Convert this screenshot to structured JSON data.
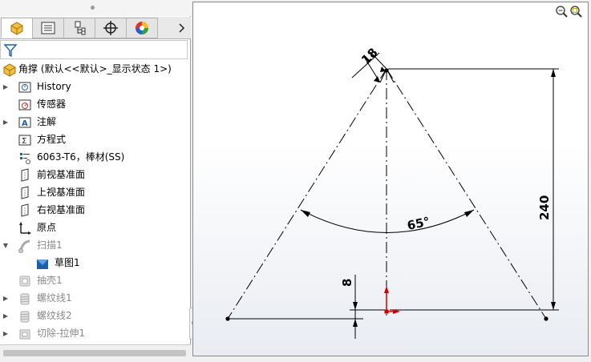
{
  "panel": {
    "tabs": [
      {
        "icon": "part-icon",
        "active": true
      },
      {
        "icon": "property-manager-icon",
        "active": false
      },
      {
        "icon": "configuration-manager-icon",
        "active": false
      },
      {
        "icon": "dimxpert-icon",
        "active": false
      },
      {
        "icon": "display-manager-icon",
        "active": false
      }
    ],
    "more_icon": "chevron-right-icon",
    "filter_icon": "filter-icon"
  },
  "tree": {
    "root_label": "角撑  (默认<<默认>_显示状态 1>)",
    "items": [
      {
        "label": "History",
        "icon": "history-icon",
        "expandable": true,
        "indent": 0,
        "disabled": false
      },
      {
        "label": "传感器",
        "icon": "sensor-icon",
        "expandable": false,
        "indent": 0,
        "disabled": false
      },
      {
        "label": "注解",
        "icon": "annotation-icon",
        "expandable": true,
        "indent": 0,
        "disabled": false
      },
      {
        "label": "方程式",
        "icon": "equation-icon",
        "expandable": false,
        "indent": 0,
        "disabled": false
      },
      {
        "label": "6063-T6，棒材(SS)",
        "icon": "material-icon",
        "expandable": false,
        "indent": 0,
        "disabled": false
      },
      {
        "label": "前视基准面",
        "icon": "plane-icon",
        "expandable": false,
        "indent": 0,
        "disabled": false
      },
      {
        "label": "上视基准面",
        "icon": "plane-icon",
        "expandable": false,
        "indent": 0,
        "disabled": false
      },
      {
        "label": "右视基准面",
        "icon": "plane-icon",
        "expandable": false,
        "indent": 0,
        "disabled": false
      },
      {
        "label": "原点",
        "icon": "origin-icon",
        "expandable": false,
        "indent": 0,
        "disabled": false
      },
      {
        "label": "扫描1",
        "icon": "sweep-icon",
        "expandable": true,
        "expanded": true,
        "indent": 0,
        "disabled": true
      },
      {
        "label": "草图1",
        "icon": "sketch-icon",
        "expandable": false,
        "indent": 1,
        "disabled": false
      },
      {
        "label": "抽壳1",
        "icon": "shell-icon",
        "expandable": false,
        "indent": 0,
        "disabled": true
      },
      {
        "label": "螺纹线1",
        "icon": "thread-icon",
        "expandable": true,
        "indent": 0,
        "disabled": true
      },
      {
        "label": "螺纹线2",
        "icon": "thread-icon",
        "expandable": true,
        "indent": 0,
        "disabled": true
      },
      {
        "label": "切除-拉伸1",
        "icon": "cut-extrude-icon",
        "expandable": true,
        "indent": 0,
        "disabled": true
      }
    ]
  },
  "sketch": {
    "dim_thickness": "18",
    "dim_height": "240",
    "dim_angle": "65°",
    "dim_offset": "8",
    "line_color": "#000000",
    "origin_color": "#cc0000"
  },
  "canvas": {
    "background": "#eef0f5",
    "zoom_icons": [
      "zoom-to-fit-icon",
      "zoom-area-icon"
    ]
  }
}
